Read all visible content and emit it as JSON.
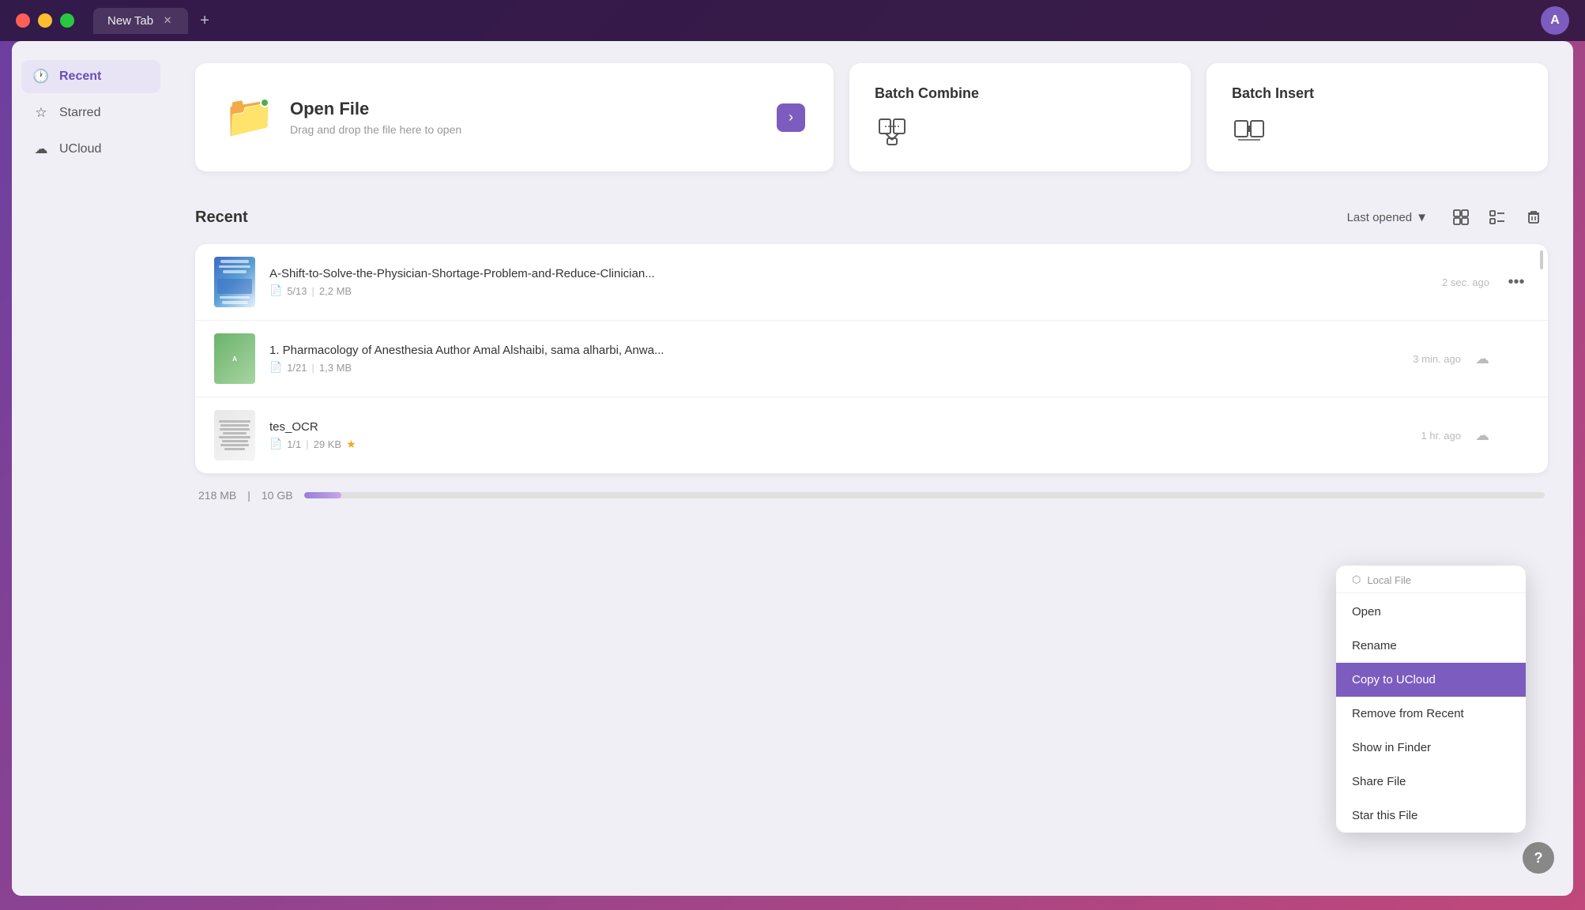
{
  "titlebar": {
    "tab_label": "New Tab",
    "avatar_letter": "A"
  },
  "sidebar": {
    "items": [
      {
        "id": "recent",
        "label": "Recent",
        "icon": "🕐",
        "active": true
      },
      {
        "id": "starred",
        "label": "Starred",
        "icon": "☆",
        "active": false
      },
      {
        "id": "ucloud",
        "label": "UCloud",
        "icon": "☁",
        "active": false
      }
    ]
  },
  "open_file_card": {
    "title": "Open File",
    "subtitle": "Drag and drop the file here to open"
  },
  "batch_combine": {
    "title": "Batch Combine"
  },
  "batch_insert": {
    "title": "Batch Insert"
  },
  "recent_section": {
    "title": "Recent",
    "sort_label": "Last opened",
    "files": [
      {
        "id": "file1",
        "name": "A-Shift-to-Solve-the-Physician-Shortage-Problem-and-Reduce-Clinician...",
        "pages": "5/13",
        "size": "2,2 MB",
        "time": "2 sec. ago",
        "has_cloud": false,
        "starred": false,
        "thumb_type": "medical"
      },
      {
        "id": "file2",
        "name": "1. Pharmacology of Anesthesia Author Amal Alshaibi, sama alharbi, Anwa...",
        "pages": "1/21",
        "size": "1,3 MB",
        "time": "3 min. ago",
        "has_cloud": true,
        "starred": false,
        "thumb_type": "pharma"
      },
      {
        "id": "file3",
        "name": "tes_OCR",
        "pages": "1/1",
        "size": "29 KB",
        "time": "1 hr. ago",
        "has_cloud": true,
        "starred": true,
        "thumb_type": "ocr"
      }
    ]
  },
  "storage": {
    "used": "218 MB",
    "total": "10 GB",
    "fill_percent": 3
  },
  "context_menu": {
    "items": [
      {
        "id": "local-file",
        "label": "Local File",
        "icon": "⬡",
        "type": "header"
      },
      {
        "id": "open",
        "label": "Open",
        "icon": ""
      },
      {
        "id": "rename",
        "label": "Rename",
        "icon": ""
      },
      {
        "id": "copy-ucloud",
        "label": "Copy to UCloud",
        "icon": "",
        "highlighted": true
      },
      {
        "id": "remove-recent",
        "label": "Remove from Recent",
        "icon": ""
      },
      {
        "id": "show-finder",
        "label": "Show in Finder",
        "icon": ""
      },
      {
        "id": "share-file",
        "label": "Share File",
        "icon": ""
      },
      {
        "id": "star-file",
        "label": "Star this File",
        "icon": ""
      }
    ]
  }
}
